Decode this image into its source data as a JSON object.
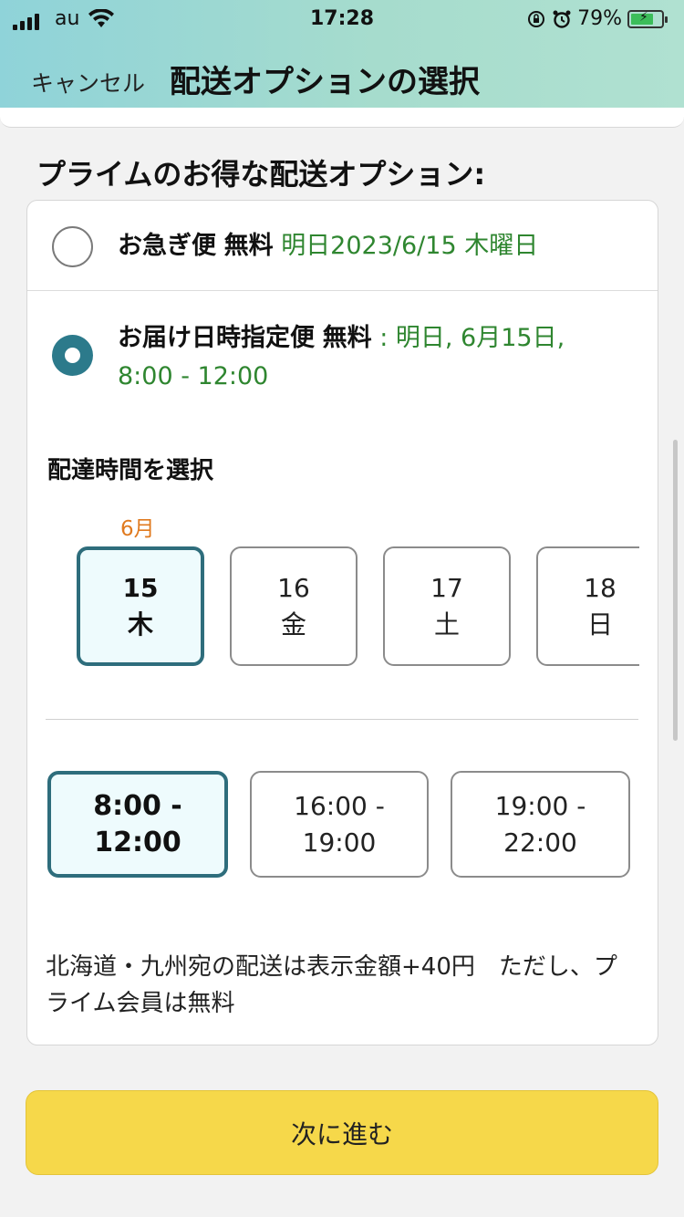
{
  "status_bar": {
    "carrier": "au",
    "time": "17:28",
    "battery_percent": "79%",
    "battery_level": 0.79
  },
  "nav": {
    "cancel_label": "キャンセル",
    "title": "配送オプションの選択"
  },
  "section_title": "プライムのお得な配送オプション:",
  "options": [
    {
      "name": "お急ぎ便",
      "price": "無料",
      "date": "明日2023/6/15 木曜日",
      "selected": false
    },
    {
      "name": "お届け日時指定便",
      "price": "無料",
      "date_line1": ": 明日, 6月15日,",
      "date_line2": "8:00 - 12:00",
      "selected": true
    }
  ],
  "time_select": {
    "heading": "配達時間を選択",
    "month": "6月",
    "days": [
      {
        "day": "15",
        "weekday": "木",
        "selected": true
      },
      {
        "day": "16",
        "weekday": "金",
        "selected": false
      },
      {
        "day": "17",
        "weekday": "土",
        "selected": false
      },
      {
        "day": "18",
        "weekday": "日",
        "selected": false
      }
    ],
    "slots": [
      {
        "line1": "8:00 -",
        "line2": "12:00",
        "selected": true
      },
      {
        "line1": "16:00 -",
        "line2": "19:00",
        "selected": false
      },
      {
        "line1": "19:00 -",
        "line2": "22:00",
        "selected": false
      }
    ]
  },
  "note": "北海道・九州宛の配送は表示金額+40円　ただし、プライム会員は無料",
  "next_button": "次に進む",
  "colors": {
    "accent_teal": "#2e6d7c",
    "green_text": "#2f8630",
    "month_orange": "#e07a1f",
    "button_yellow": "#f6d84a"
  }
}
